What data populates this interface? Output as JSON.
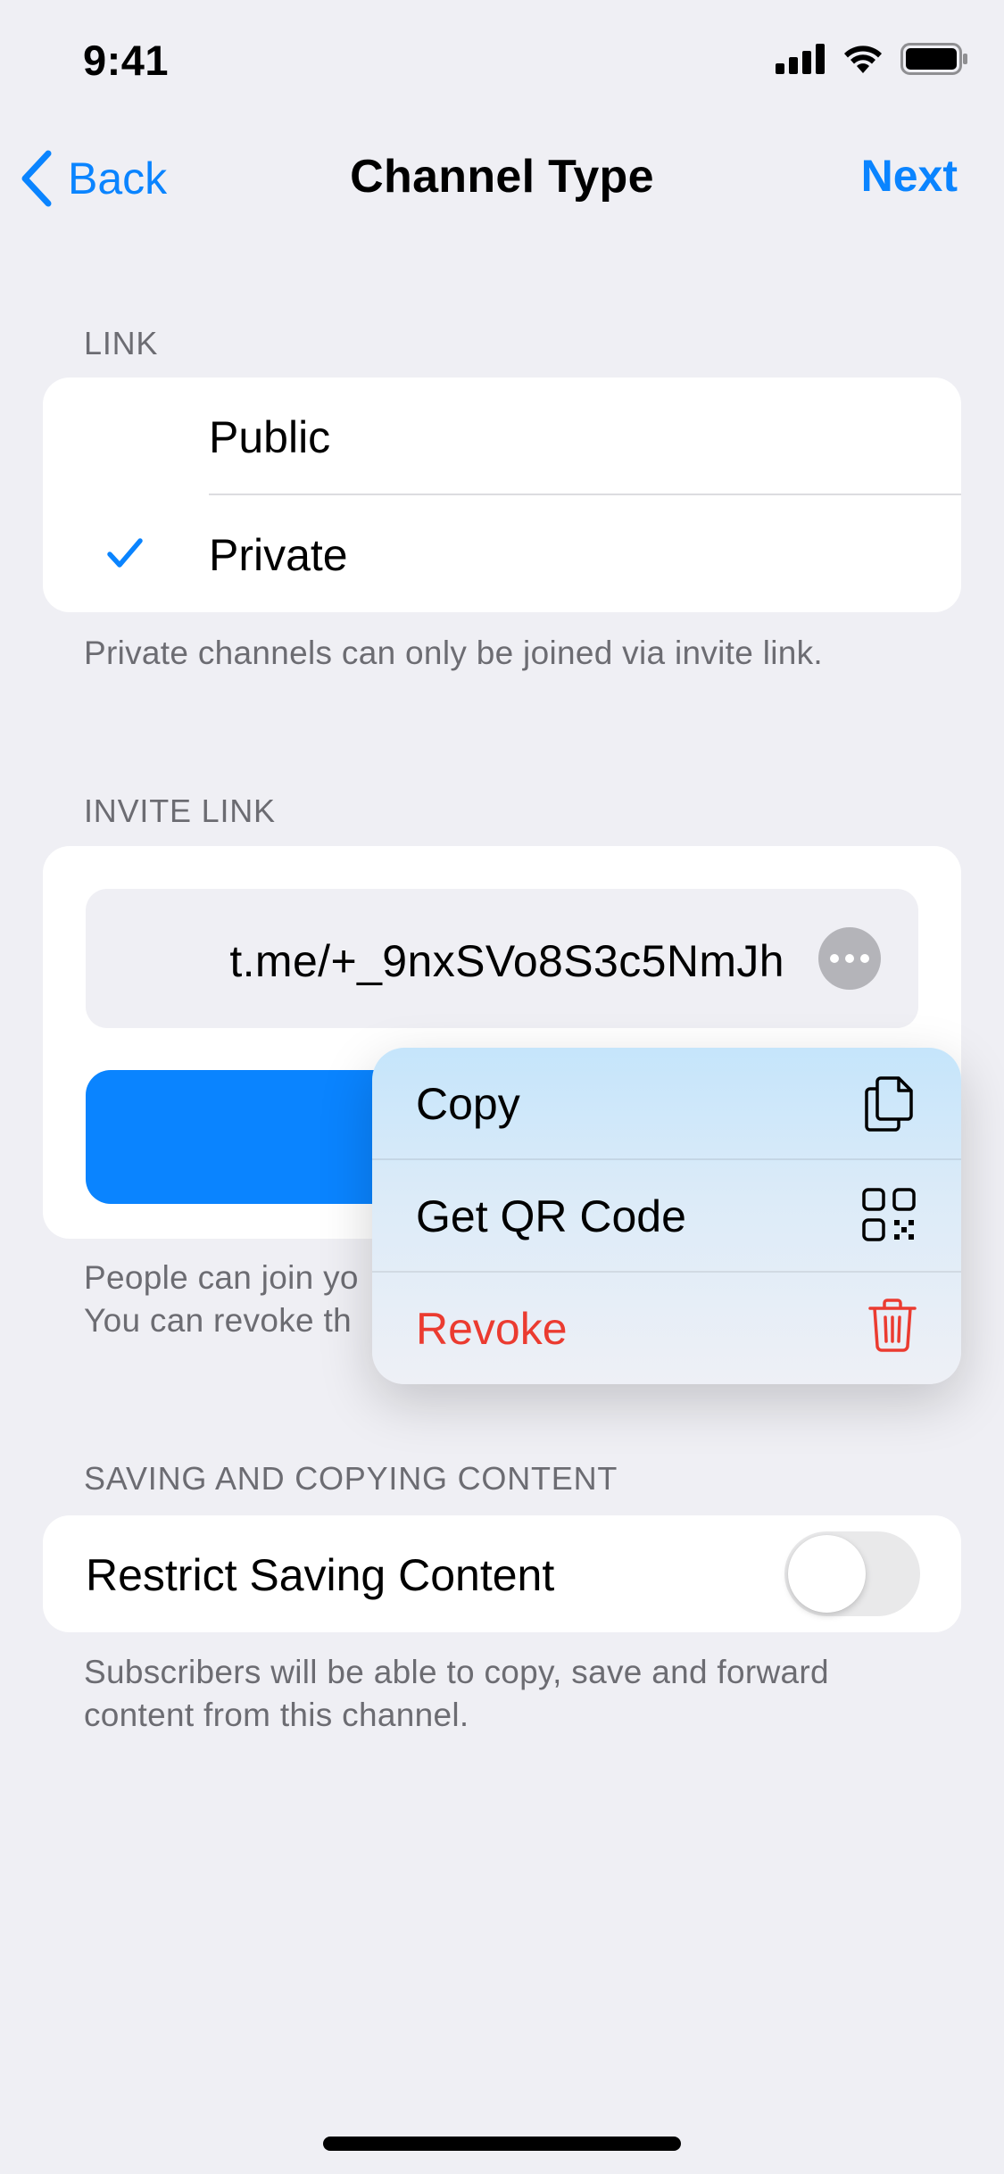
{
  "status_bar": {
    "time": "9:41"
  },
  "nav": {
    "back_label": "Back",
    "title": "Channel Type",
    "next_label": "Next"
  },
  "link_section": {
    "header": "LINK",
    "options": [
      {
        "label": "Public",
        "selected": false
      },
      {
        "label": "Private",
        "selected": true
      }
    ],
    "footer": "Private channels can only be joined via invite link."
  },
  "invite_link_section": {
    "header": "INVITE LINK",
    "link": "t.me/+_9nxSVo8S3c5NmJh",
    "footer_line1": "People can join yo",
    "footer_line2": "You can revoke th"
  },
  "context_menu": {
    "items": [
      {
        "label": "Copy",
        "icon": "copy-icon",
        "color": "#000000"
      },
      {
        "label": "Get QR Code",
        "icon": "qr-code-icon",
        "color": "#000000"
      },
      {
        "label": "Revoke",
        "icon": "trash-icon",
        "color": "#EB3B30"
      }
    ]
  },
  "saving_section": {
    "header": "SAVING AND COPYING CONTENT",
    "toggle_label": "Restrict Saving Content",
    "toggle_on": false,
    "footer_line1": "Subscribers will be able to copy, save and forward",
    "footer_line2": "content from this channel."
  },
  "colors": {
    "accent": "#0A84FF",
    "destructive": "#EB3B30",
    "background": "#EFEFF4"
  }
}
